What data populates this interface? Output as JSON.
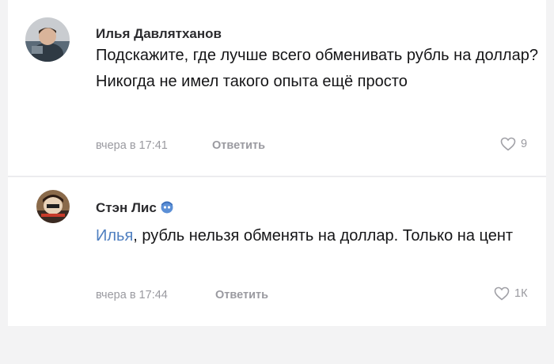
{
  "comments": [
    {
      "author": "Илья Давлятханов",
      "text": "Подскажите, где лучше всего обменивать рубль на доллар? Никогда не имел такого опыта ещё просто",
      "time": "вчера в 17:41",
      "reply_label": "Ответить",
      "likes": "9",
      "avatar_icon": "user-photo-avatar"
    },
    {
      "author": "Стэн Лис",
      "mention": "Илья",
      "text": ", рубль нельзя обменять на доллар. Только на цент",
      "time": "вчера в 17:44",
      "reply_label": "Ответить",
      "likes": "1К",
      "avatar_icon": "user-photo-avatar",
      "badge_icon": "donut-badge-icon"
    }
  ],
  "colors": {
    "mention": "#4f7fc0",
    "meta": "#9a9aa0",
    "background": "#ffffff"
  }
}
